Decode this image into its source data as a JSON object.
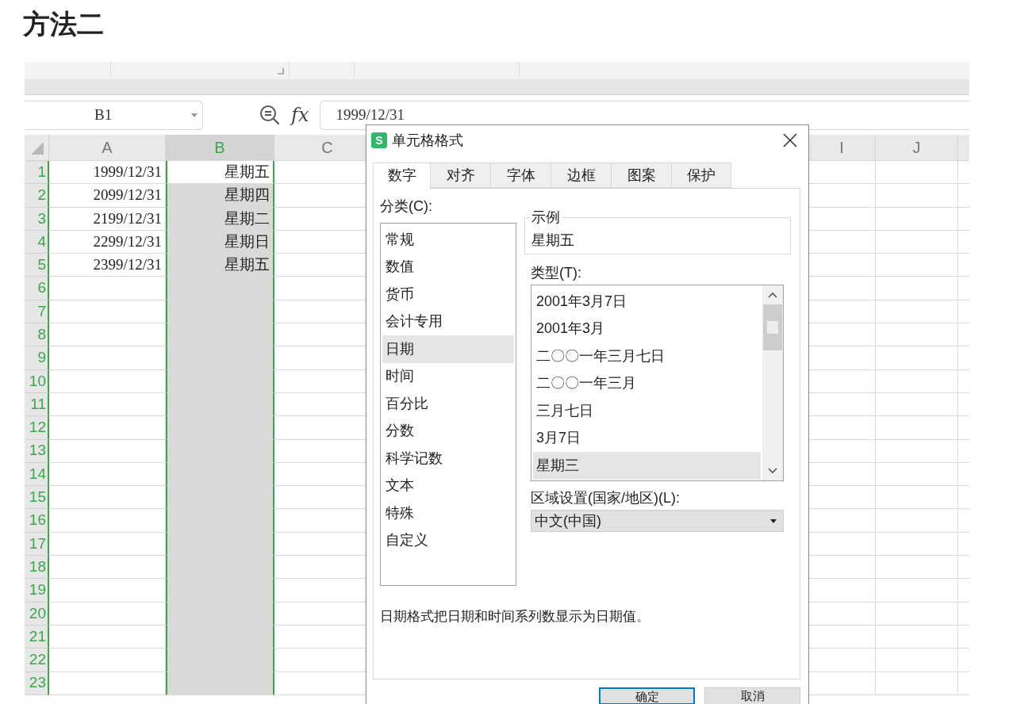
{
  "heading": "方法二",
  "spreadsheet": {
    "name_box": "B1",
    "function_label": "fx",
    "formula": "1999/12/31",
    "left_columns": [
      {
        "label": "A",
        "selected": false
      },
      {
        "label": "B",
        "selected": true
      },
      {
        "label": "C",
        "selected": false
      }
    ],
    "right_columns": [
      {
        "label": "I",
        "selected": false
      },
      {
        "label": "J",
        "selected": false
      }
    ],
    "rows": [
      {
        "number": "1",
        "selected": true,
        "active": true,
        "cells": [
          "1999/12/31",
          "星期五"
        ]
      },
      {
        "number": "2",
        "selected": true,
        "active": false,
        "cells": [
          "2099/12/31",
          "星期四"
        ]
      },
      {
        "number": "3",
        "selected": true,
        "active": false,
        "cells": [
          "2199/12/31",
          "星期二"
        ]
      },
      {
        "number": "4",
        "selected": true,
        "active": false,
        "cells": [
          "2299/12/31",
          "星期日"
        ]
      },
      {
        "number": "5",
        "selected": true,
        "active": false,
        "cells": [
          "2399/12/31",
          "星期五"
        ]
      },
      {
        "number": "6",
        "selected": true,
        "active": false
      },
      {
        "number": "7",
        "selected": true,
        "active": false
      },
      {
        "number": "8",
        "selected": true,
        "active": false
      },
      {
        "number": "9",
        "selected": true,
        "active": false
      },
      {
        "number": "10",
        "selected": true,
        "active": false
      },
      {
        "number": "11",
        "selected": true,
        "active": false
      },
      {
        "number": "12",
        "selected": true,
        "active": false
      },
      {
        "number": "13",
        "selected": true,
        "active": false
      },
      {
        "number": "14",
        "selected": true,
        "active": false
      },
      {
        "number": "15",
        "selected": true,
        "active": false
      },
      {
        "number": "16",
        "selected": true,
        "active": false
      },
      {
        "number": "17",
        "selected": true,
        "active": false
      },
      {
        "number": "18",
        "selected": true,
        "active": false
      },
      {
        "number": "19",
        "selected": true,
        "active": false
      },
      {
        "number": "20",
        "selected": true,
        "active": false
      },
      {
        "number": "21",
        "selected": true,
        "active": false
      },
      {
        "number": "22",
        "selected": true,
        "active": false
      },
      {
        "number": "23",
        "selected": true,
        "active": false
      }
    ]
  },
  "dialog": {
    "app_badge": "S",
    "title": "单元格格式",
    "tabs": [
      {
        "label": "数字",
        "selected": true
      },
      {
        "label": "对齐",
        "selected": false
      },
      {
        "label": "字体",
        "selected": false
      },
      {
        "label": "边框",
        "selected": false
      },
      {
        "label": "图案",
        "selected": false
      },
      {
        "label": "保护",
        "selected": false
      }
    ],
    "category_label": "分类(C):",
    "categories": [
      {
        "label": "常规",
        "selected": false
      },
      {
        "label": "数值",
        "selected": false
      },
      {
        "label": "货币",
        "selected": false
      },
      {
        "label": "会计专用",
        "selected": false
      },
      {
        "label": "日期",
        "selected": true
      },
      {
        "label": "时间",
        "selected": false
      },
      {
        "label": "百分比",
        "selected": false
      },
      {
        "label": "分数",
        "selected": false
      },
      {
        "label": "科学记数",
        "selected": false
      },
      {
        "label": "文本",
        "selected": false
      },
      {
        "label": "特殊",
        "selected": false
      },
      {
        "label": "自定义",
        "selected": false
      }
    ],
    "sample_label": "示例",
    "sample_value": "星期五",
    "type_label": "类型(T):",
    "types": [
      {
        "label": "2001年3月7日",
        "selected": false
      },
      {
        "label": "2001年3月",
        "selected": false
      },
      {
        "label": "二〇〇一年三月七日",
        "selected": false
      },
      {
        "label": "二〇〇一年三月",
        "selected": false
      },
      {
        "label": "三月七日",
        "selected": false
      },
      {
        "label": "3月7日",
        "selected": false
      },
      {
        "label": "星期三",
        "selected": true
      }
    ],
    "locale_label": "区域设置(国家/地区)(L):",
    "locale_value": "中文(中国)",
    "description": "日期格式把日期和时间系列数显示为日期值。",
    "buttons": [
      "确定",
      "取消"
    ]
  }
}
